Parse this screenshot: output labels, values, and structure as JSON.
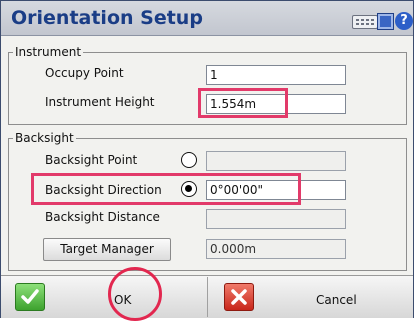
{
  "window": {
    "title": "Orientation Setup",
    "icons": [
      "keyboard-icon",
      "grid-icon",
      "help-icon"
    ],
    "help_glyph": "?"
  },
  "instrument": {
    "legend": "Instrument",
    "occupy_point_label": "Occupy Point",
    "occupy_point_value": "1",
    "instrument_height_label": "Instrument Height",
    "instrument_height_value": "1.554m"
  },
  "backsight": {
    "legend": "Backsight",
    "backsight_point_label": "Backsight Point",
    "backsight_point_value": "",
    "backsight_direction_label": "Backsight Direction",
    "backsight_direction_value": "0°00'00\"",
    "backsight_distance_label": "Backsight Distance",
    "backsight_distance_value": "",
    "target_manager_label": "Target Manager",
    "target_value": "0.000m",
    "selected_option": "Backsight Direction"
  },
  "footer": {
    "ok_label": "OK",
    "cancel_label": "Cancel"
  },
  "colors": {
    "highlight": "#e23a6a",
    "title_text": "#1a3d86"
  }
}
